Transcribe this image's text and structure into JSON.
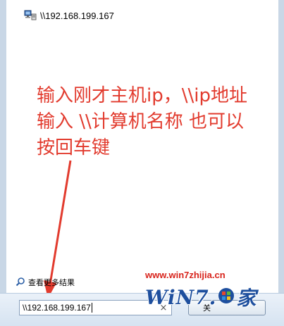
{
  "result": {
    "icon": "network-computer-icon",
    "text": "\\\\192.168.199.167"
  },
  "annotation": {
    "lines": [
      "输入刚才主机ip，\\\\ip地址",
      "输入 \\\\计算机名称 也可以",
      "按回车键"
    ],
    "color": "#e23b2e"
  },
  "see_more": {
    "icon": "search-icon",
    "label": "查看更多结果"
  },
  "search": {
    "value": "\\\\192.168.199.167",
    "clear_icon": "close-icon"
  },
  "close_button": {
    "label": "关"
  },
  "watermark": {
    "url": "www.win7zhijia.cn",
    "logo": "WiN7.",
    "logo_suffix": "家"
  }
}
